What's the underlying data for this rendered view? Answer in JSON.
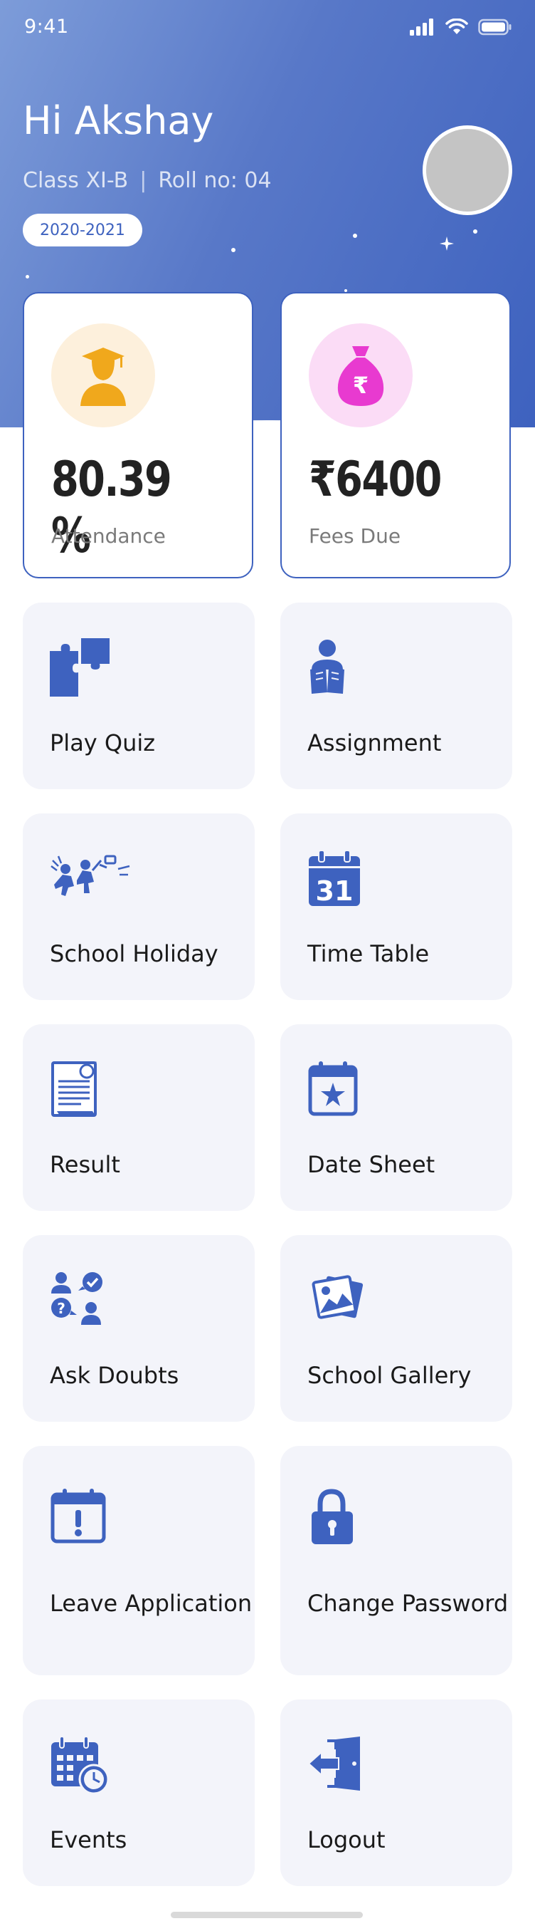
{
  "status_bar": {
    "time": "9:41"
  },
  "header": {
    "greeting": "Hi Akshay",
    "class": "Class XI-B",
    "separator": "|",
    "roll": "Roll no: 04",
    "session": "2020-2021"
  },
  "stats": [
    {
      "value": "80.39 %",
      "label": "Attendance",
      "icon": "student-icon",
      "bg": "#fdf0dc",
      "color": "#f0a81c"
    },
    {
      "value": "₹6400",
      "label": "Fees Due",
      "icon": "money-bag-icon",
      "bg": "#fbdcf6",
      "color": "#e83ad0"
    }
  ],
  "menu": [
    {
      "label": "Play Quiz",
      "icon": "puzzle-icon"
    },
    {
      "label": "Assignment",
      "icon": "reading-icon"
    },
    {
      "label": "School Holiday",
      "icon": "kids-running-icon"
    },
    {
      "label": "Time Table",
      "icon": "calendar-31-icon"
    },
    {
      "label": "Result",
      "icon": "report-icon"
    },
    {
      "label": "Date Sheet",
      "icon": "calendar-star-icon"
    },
    {
      "label": "Ask Doubts",
      "icon": "people-question-icon"
    },
    {
      "label": "School Gallery",
      "icon": "gallery-icon"
    },
    {
      "label": "Leave Application",
      "icon": "calendar-alert-icon"
    },
    {
      "label": "Change Password",
      "icon": "lock-icon"
    },
    {
      "label": "Events",
      "icon": "calendar-clock-icon"
    },
    {
      "label": "Logout",
      "icon": "logout-door-icon"
    }
  ],
  "colors": {
    "primary": "#3e62bf",
    "tile_bg": "#f3f4fa"
  }
}
